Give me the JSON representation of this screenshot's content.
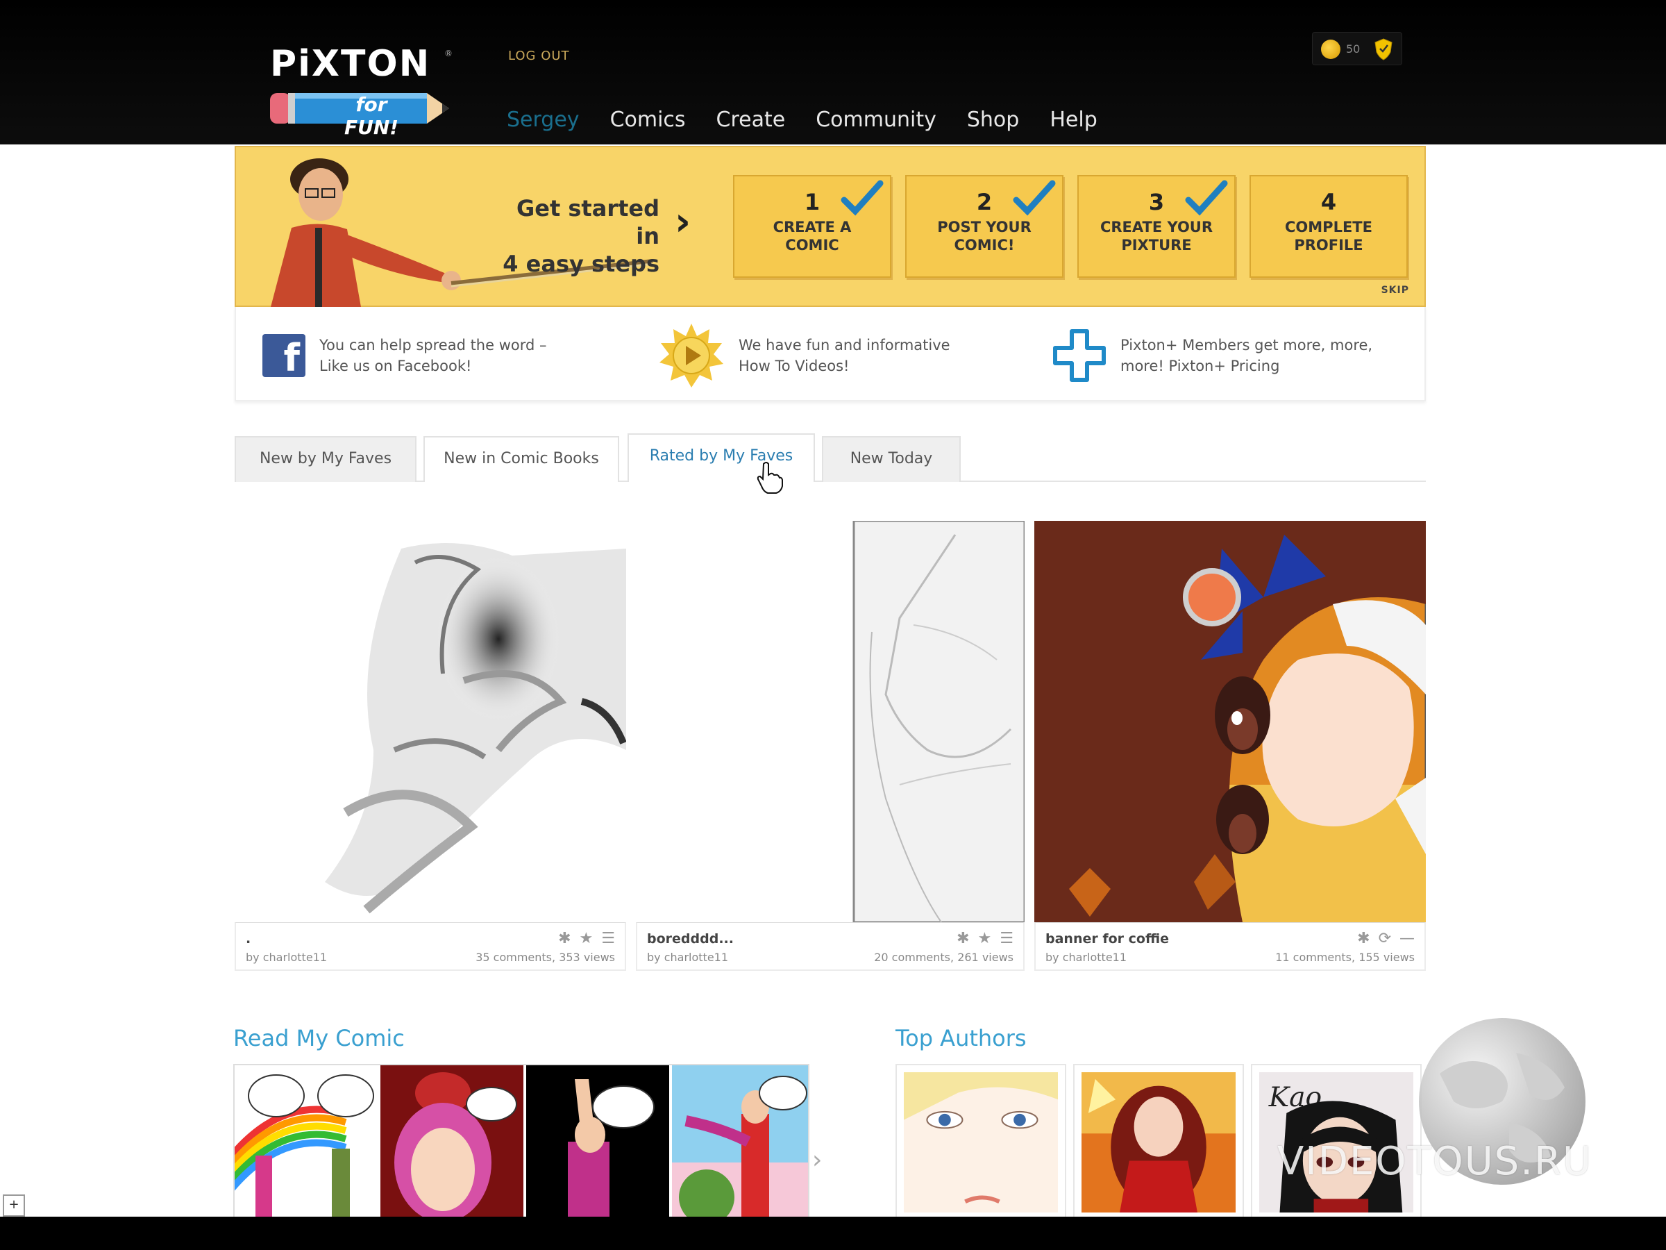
{
  "header": {
    "logo_text": "PiXTON",
    "logo_sub": "for FUN!",
    "logout": "LOG OUT",
    "nav": [
      "Sergey",
      "Comics",
      "Create",
      "Community",
      "Shop",
      "Help"
    ],
    "points": "50"
  },
  "steps": {
    "heading_line1": "Get started in",
    "heading_line2": "4 easy steps",
    "items": [
      {
        "num": "1",
        "label_line1": "CREATE A",
        "label_line2": "COMIC",
        "done": true
      },
      {
        "num": "2",
        "label_line1": "POST YOUR",
        "label_line2": "COMIC!",
        "done": true
      },
      {
        "num": "3",
        "label_line1": "CREATE YOUR",
        "label_line2": "PIXTURE",
        "done": true
      },
      {
        "num": "4",
        "label_line1": "COMPLETE",
        "label_line2": "PROFILE",
        "done": false
      }
    ],
    "skip": "SKIP"
  },
  "info": {
    "facebook": {
      "line1": "You can help spread the word –",
      "line2": "Like us on Facebook!"
    },
    "videos": {
      "line1": "We have fun and informative",
      "line2": "How To Videos!"
    },
    "pixtonplus": {
      "line1": "Pixton+ Members get more, more,",
      "line2": "more! Pixton+ Pricing"
    }
  },
  "tabs": [
    "New by My Faves",
    "New in Comic Books",
    "Rated by My Faves",
    "New Today"
  ],
  "active_tab": "Rated by My Faves",
  "featured": [
    {
      "title": ".",
      "author": "by charlotte11",
      "stats": "35 comments, 353 views"
    },
    {
      "title": "boredddd...",
      "author": "by charlotte11",
      "stats": "20 comments, 261 views"
    },
    {
      "title": "banner for coffie",
      "author": "by charlotte11",
      "stats": "11 comments, 155 views"
    }
  ],
  "sections": {
    "read_my_comic": "Read My Comic",
    "top_authors": "Top Authors",
    "comic_bubbles": [
      "",
      "",
      "",
      "",
      ""
    ]
  },
  "watermark": "VIDEOTOUS.RU",
  "colors": {
    "header_bg": "#000000",
    "banner_yellow": "#f8d468",
    "accent_blue": "#2a7db0",
    "section_blue": "#3aa0d0",
    "checkmark": "#1f7fc0"
  }
}
